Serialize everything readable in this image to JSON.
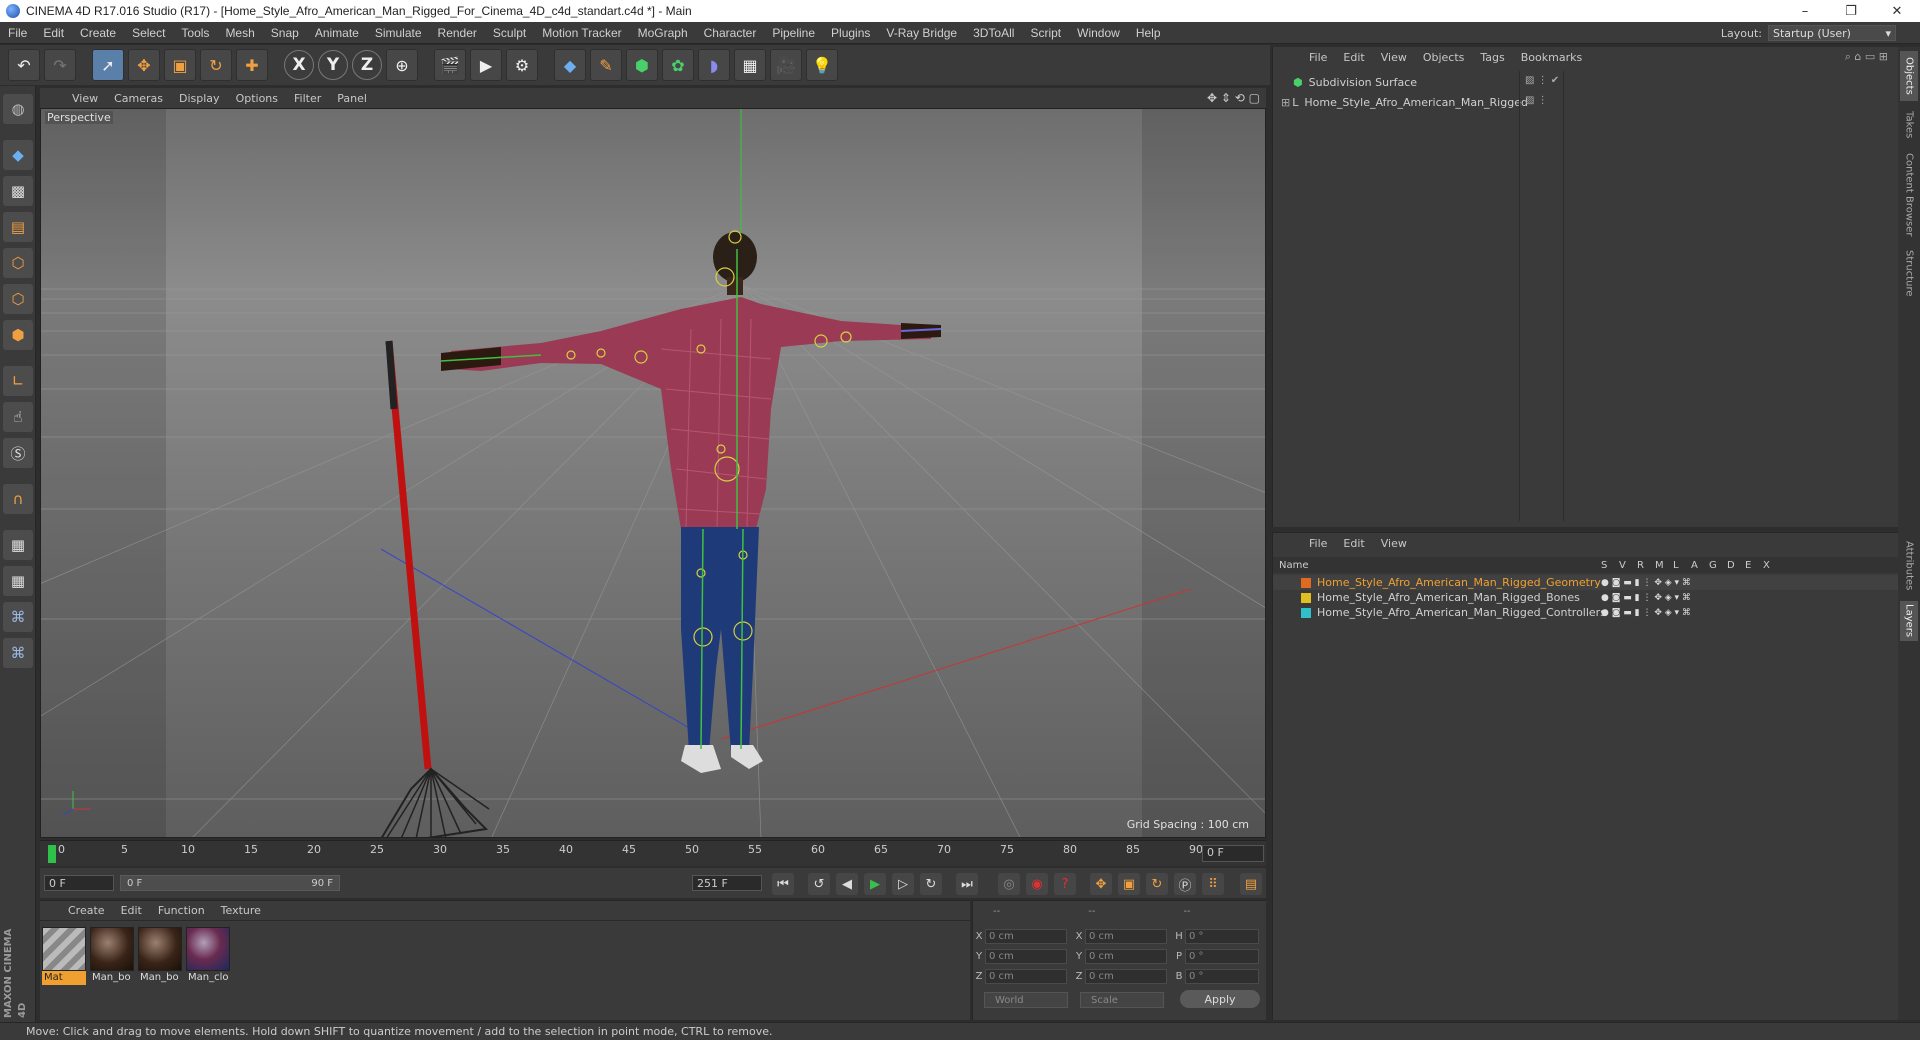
{
  "window": {
    "title": "CINEMA 4D R17.016 Studio (R17) - [Home_Style_Afro_American_Man_Rigged_For_Cinema_4D_c4d_standart.c4d *] - Main",
    "minimize": "–",
    "maximize": "❐",
    "close": "✕"
  },
  "menubar": {
    "items": [
      "File",
      "Edit",
      "Create",
      "Select",
      "Tools",
      "Mesh",
      "Snap",
      "Animate",
      "Simulate",
      "Render",
      "Sculpt",
      "Motion Tracker",
      "MoGraph",
      "Character",
      "Pipeline",
      "Plugins",
      "V-Ray Bridge",
      "3DToAll",
      "Script",
      "Window",
      "Help"
    ],
    "layout_label": "Layout:",
    "layout_value": "Startup (User)"
  },
  "toolbar": {
    "axis_x": "X",
    "axis_y": "Y",
    "axis_z": "Z"
  },
  "viewport": {
    "menu": [
      "View",
      "Cameras",
      "Display",
      "Options",
      "Filter",
      "Panel"
    ],
    "label": "Perspective",
    "grid_spacing": "Grid Spacing : 100 cm"
  },
  "timeline": {
    "ticks": [
      "0",
      "5",
      "10",
      "15",
      "20",
      "25",
      "30",
      "35",
      "40",
      "45",
      "50",
      "55",
      "60",
      "65",
      "70",
      "75",
      "80",
      "85",
      "90"
    ],
    "current_frame": "0 F"
  },
  "transport": {
    "start_field": "0 F",
    "range_start": "0 F",
    "range_end": "90 F",
    "end_field": "251 F"
  },
  "materials": {
    "menu": [
      "Create",
      "Edit",
      "Function",
      "Texture"
    ],
    "items": [
      {
        "label": "Mat",
        "selected": true
      },
      {
        "label": "Man_bo",
        "selected": false
      },
      {
        "label": "Man_bo",
        "selected": false
      },
      {
        "label": "Man_clo",
        "selected": false
      }
    ]
  },
  "coordinates": {
    "headers": [
      "--",
      "--",
      "--"
    ],
    "rows": [
      {
        "a": "X",
        "av": "0 cm",
        "b": "X",
        "bv": "0 cm",
        "c": "H",
        "cv": "0 °"
      },
      {
        "a": "Y",
        "av": "0 cm",
        "b": "Y",
        "bv": "0 cm",
        "c": "P",
        "cv": "0 °"
      },
      {
        "a": "Z",
        "av": "0 cm",
        "b": "Z",
        "bv": "0 cm",
        "c": "B",
        "cv": "0 °"
      }
    ],
    "world": "World",
    "scale": "Scale",
    "apply": "Apply"
  },
  "objects_panel": {
    "menu": [
      "File",
      "Edit",
      "View",
      "Objects",
      "Tags",
      "Bookmarks"
    ],
    "items": [
      {
        "name": "Subdivision Surface"
      },
      {
        "name": "Home_Style_Afro_American_Man_Rigged"
      }
    ]
  },
  "layers_panel": {
    "menu": [
      "File",
      "Edit",
      "View"
    ],
    "columns": [
      "Name",
      "S",
      "V",
      "R",
      "M",
      "L",
      "A",
      "G",
      "D",
      "E",
      "X"
    ],
    "layers": [
      {
        "name": "Home_Style_Afro_American_Man_Rigged_Geometry",
        "color": "#e06a20",
        "text_color": "#f0a030"
      },
      {
        "name": "Home_Style_Afro_American_Man_Rigged_Bones",
        "color": "#e0c020",
        "text_color": "#d0d0d0"
      },
      {
        "name": "Home_Style_Afro_American_Man_Rigged_Controllers",
        "color": "#30c0c8",
        "text_color": "#d0d0d0"
      }
    ]
  },
  "side_tabs": [
    "Objects",
    "Takes",
    "Content Browser",
    "Structure",
    "Attributes",
    "Layers"
  ],
  "status": "Move: Click and drag to move elements. Hold down SHIFT to quantize movement / add to the selection in point mode, CTRL to remove.",
  "maxon_logo": "MAXON CINEMA 4D"
}
